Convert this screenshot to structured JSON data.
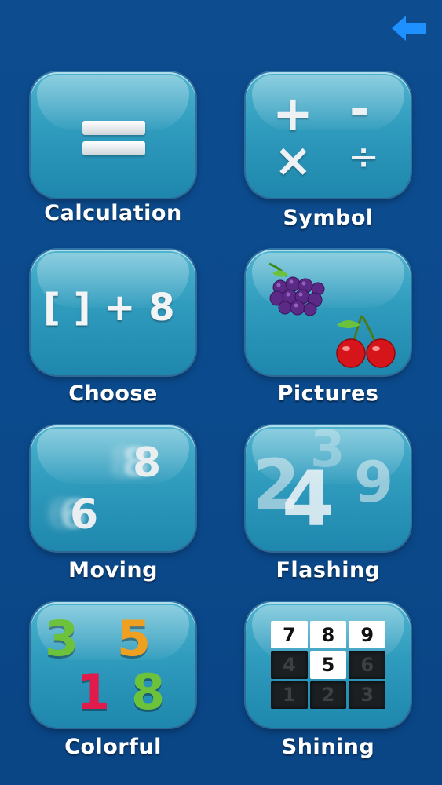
{
  "nav": {
    "back_icon": "back-arrow-icon"
  },
  "colors": {
    "accent_blue": "#1e90ff",
    "tile": "#2f9bbd",
    "background": "#0b4a8c"
  },
  "modes": {
    "calculation": {
      "label": "Calculation",
      "icon": "equals-icon"
    },
    "symbol": {
      "label": "Symbol",
      "icon": "operators-icon",
      "plus": "+",
      "minus": "-",
      "times": "×",
      "divide": "÷"
    },
    "choose": {
      "label": "Choose",
      "icon": "brackets-icon",
      "text": "[ ] + 8"
    },
    "pictures": {
      "label": "Pictures",
      "icon": "fruit-icon"
    },
    "moving": {
      "label": "Moving",
      "icon": "moving-numbers-icon",
      "num_a": "8",
      "num_b": "6"
    },
    "flashing": {
      "label": "Flashing",
      "icon": "flashing-numbers-icon",
      "n1": "2",
      "n2": "3",
      "n3": "9",
      "n4": "4"
    },
    "colorful": {
      "label": "Colorful",
      "icon": "colored-numbers-icon",
      "n1": "3",
      "n2": "5",
      "n3": "1",
      "n4": "8"
    },
    "shining": {
      "label": "Shining",
      "icon": "number-grid-icon",
      "cells": [
        "7",
        "8",
        "9",
        "4",
        "5",
        "6",
        "1",
        "2",
        "3"
      ]
    }
  }
}
